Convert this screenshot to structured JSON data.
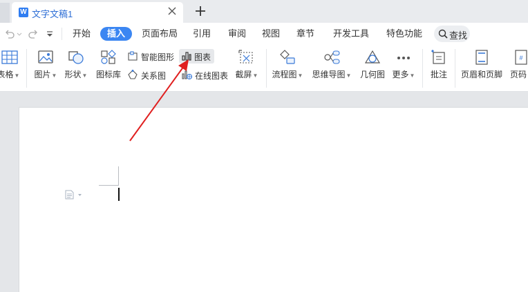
{
  "app": {
    "tab_title": "文字文稿1",
    "logo_letter": "W",
    "accent_color": "#3b86f2",
    "annotation_arrow_color": "#e02020"
  },
  "menu": {
    "items": [
      "开始",
      "插入",
      "页面布局",
      "引用",
      "审阅",
      "视图",
      "章节",
      "开发工具",
      "特色功能"
    ],
    "active": "插入",
    "search_label": "查找"
  },
  "ribbon": {
    "table": "表格",
    "picture": "图片",
    "shape": "形状",
    "icon_library": "图标库",
    "smart_graphic": "智能图形",
    "chart": "图表",
    "relation_graph": "关系图",
    "online_chart": "在线图表",
    "screenshot": "截屏",
    "flowchart": "流程图",
    "mindmap": "思维导图",
    "geometry": "几何图",
    "more": "更多",
    "comment": "批注",
    "header_footer": "页眉和页脚",
    "page_number": "页码"
  }
}
